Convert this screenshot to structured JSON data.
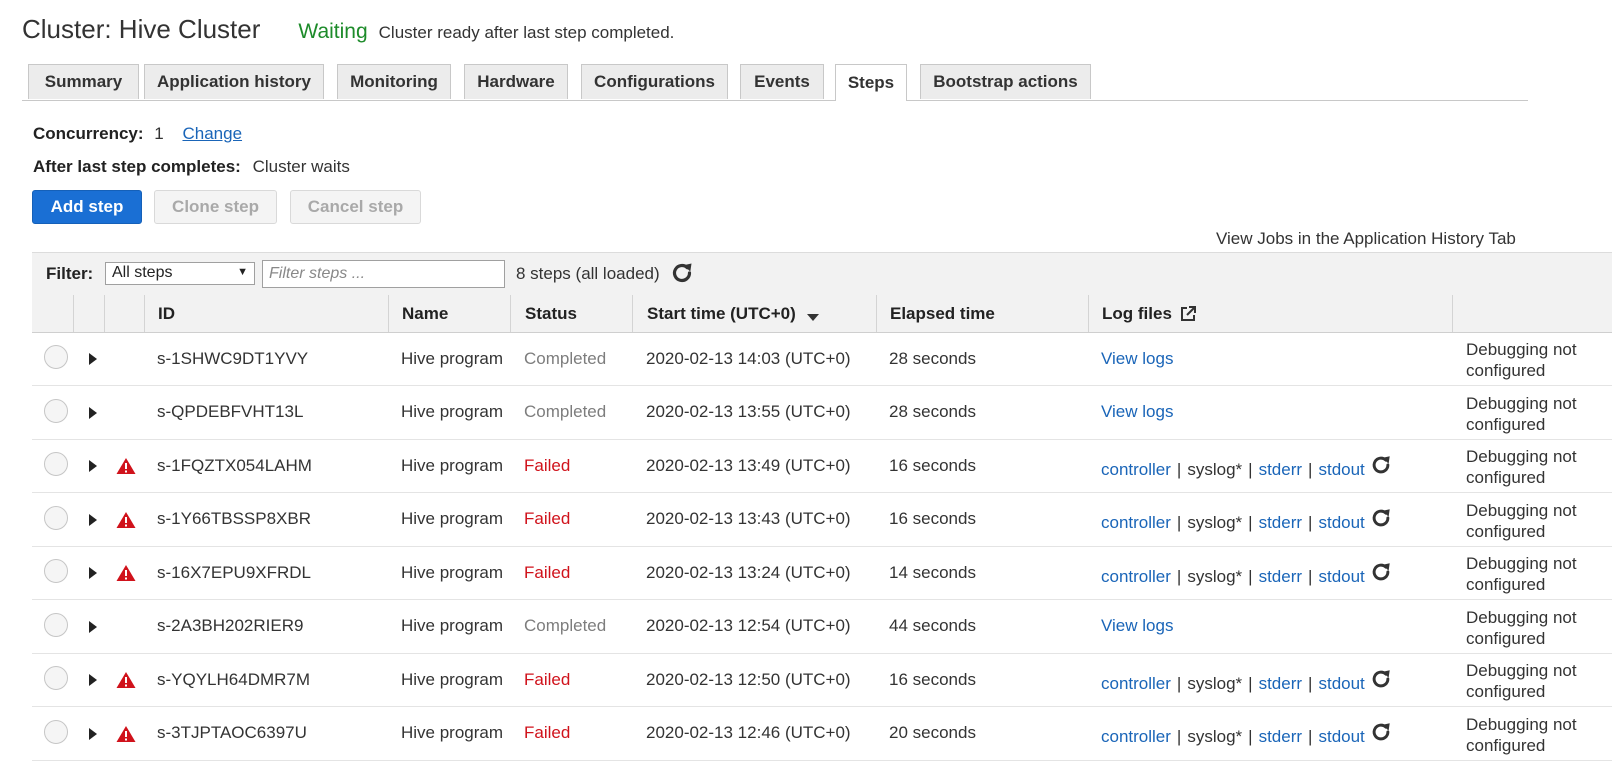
{
  "header": {
    "title": "Cluster: Hive Cluster",
    "status": "Waiting",
    "status_desc": "Cluster ready after last step completed."
  },
  "tabs": [
    {
      "label": "Summary"
    },
    {
      "label": "Application history"
    },
    {
      "label": "Monitoring"
    },
    {
      "label": "Hardware"
    },
    {
      "label": "Configurations"
    },
    {
      "label": "Events"
    },
    {
      "label": "Steps",
      "active": true
    },
    {
      "label": "Bootstrap actions"
    }
  ],
  "concurrency": {
    "label": "Concurrency:",
    "value": "1",
    "change_link": "Change"
  },
  "after_last_step": {
    "label": "After last step completes:",
    "value": "Cluster waits"
  },
  "buttons": {
    "add": "Add step",
    "clone": "Clone step",
    "cancel": "Cancel step"
  },
  "view_jobs": "View Jobs in the Application History Tab",
  "filter": {
    "label": "Filter:",
    "select_value": "All steps",
    "input_placeholder": "Filter steps ...",
    "count": "8 steps (all loaded)"
  },
  "table": {
    "headers": {
      "id": "ID",
      "name": "Name",
      "status": "Status",
      "start_time": "Start time (UTC+0)",
      "elapsed": "Elapsed time",
      "log_files": "Log files"
    },
    "log_labels": {
      "view_logs": "View logs",
      "controller": "controller",
      "syslog": "syslog*",
      "stderr": "stderr",
      "stdout": "stdout",
      "sep": "|"
    },
    "debugging": {
      "line1": "Debugging not",
      "line2": "configured"
    },
    "rows": [
      {
        "id": "s-1SHWC9DT1YVY",
        "name": "Hive program",
        "status": "Completed",
        "start": "2020-02-13 14:03 (UTC+0)",
        "elapsed": "28 seconds",
        "failed": false
      },
      {
        "id": "s-QPDEBFVHT13L",
        "name": "Hive program",
        "status": "Completed",
        "start": "2020-02-13 13:55 (UTC+0)",
        "elapsed": "28 seconds",
        "failed": false
      },
      {
        "id": "s-1FQZTX054LAHM",
        "name": "Hive program",
        "status": "Failed",
        "start": "2020-02-13 13:49 (UTC+0)",
        "elapsed": "16 seconds",
        "failed": true
      },
      {
        "id": "s-1Y66TBSSP8XBR",
        "name": "Hive program",
        "status": "Failed",
        "start": "2020-02-13 13:43 (UTC+0)",
        "elapsed": "16 seconds",
        "failed": true
      },
      {
        "id": "s-16X7EPU9XFRDL",
        "name": "Hive program",
        "status": "Failed",
        "start": "2020-02-13 13:24 (UTC+0)",
        "elapsed": "14 seconds",
        "failed": true
      },
      {
        "id": "s-2A3BH202RIER9",
        "name": "Hive program",
        "status": "Completed",
        "start": "2020-02-13 12:54 (UTC+0)",
        "elapsed": "44 seconds",
        "failed": false
      },
      {
        "id": "s-YQYLH64DMR7M",
        "name": "Hive program",
        "status": "Failed",
        "start": "2020-02-13 12:50 (UTC+0)",
        "elapsed": "16 seconds",
        "failed": true
      },
      {
        "id": "s-3TJPTAOC6397U",
        "name": "Hive program",
        "status": "Failed",
        "start": "2020-02-13 12:46 (UTC+0)",
        "elapsed": "20 seconds",
        "failed": true
      }
    ]
  },
  "colors": {
    "waiting": "#1d8b2a",
    "failed": "#d0121b",
    "completed": "#7d7d7d",
    "link": "#1a65b8",
    "primary_button": "#1a6fd4",
    "warning_icon": "#d0121b"
  },
  "icons": {
    "refresh": "refresh-icon",
    "warning": "warning-triangle-icon",
    "expand": "expand-caret-icon",
    "external": "external-link-icon",
    "sort": "sort-descending-icon",
    "dropdown": "dropdown-caret-icon"
  }
}
